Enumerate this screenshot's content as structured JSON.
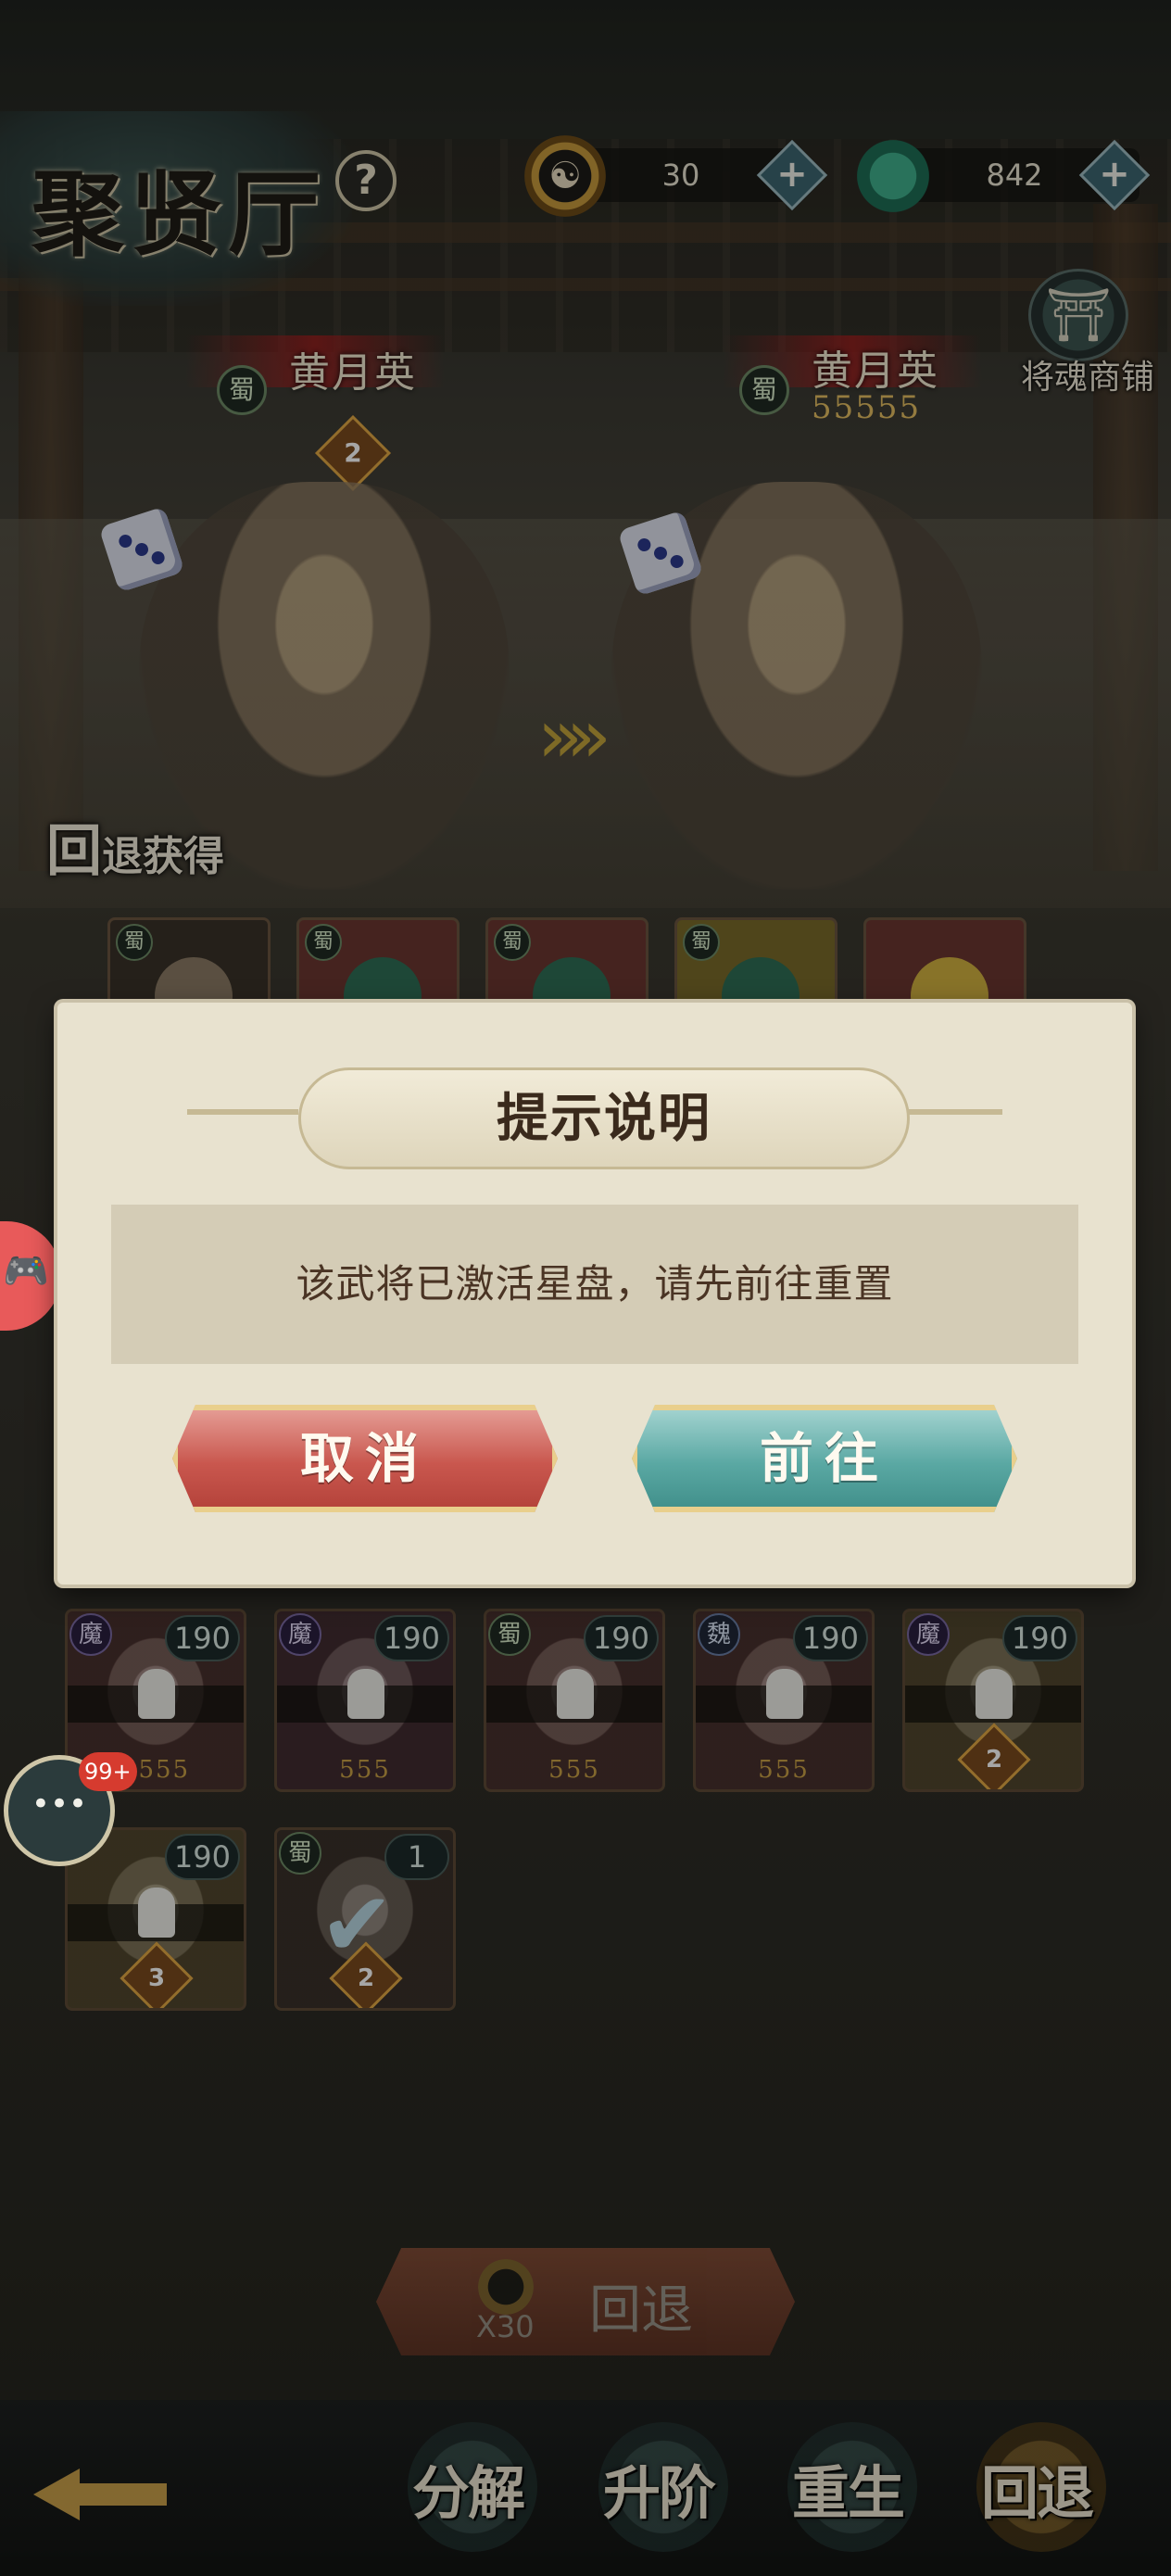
{
  "header": {
    "title": "聚贤厅",
    "help_icon": "question-mark-icon",
    "currency_yinyang": {
      "icon": "yinyang-coin-icon",
      "amount": "30"
    },
    "currency_jade": {
      "icon": "jade-dragon-icon",
      "amount": "842"
    },
    "plus_label": "+",
    "soul_shop_label": "将魂商铺"
  },
  "hero_preview": {
    "faction": "蜀",
    "left": {
      "name": "黄月英",
      "rank": "2"
    },
    "right": {
      "name": "黄月英",
      "souls": "55555"
    }
  },
  "retreat_section": {
    "label_main": "回",
    "label_sub": "退获得",
    "slots": [
      {
        "faction": "蜀",
        "color": "#8a7a64"
      },
      {
        "faction": "蜀",
        "color": "#2f6e55"
      },
      {
        "faction": "蜀",
        "color": "#2f6e55"
      },
      {
        "faction": "蜀",
        "color": "#2f6e55"
      },
      {
        "faction": "",
        "color": "#d2b13f"
      }
    ]
  },
  "hero_cards": [
    {
      "faction": "魔",
      "level": "190",
      "stars": "5555",
      "rank": ""
    },
    {
      "faction": "魔",
      "level": "190",
      "stars": "555",
      "rank": ""
    },
    {
      "faction": "蜀",
      "level": "190",
      "stars": "555",
      "rank": ""
    },
    {
      "faction": "魏",
      "level": "190",
      "stars": "555",
      "rank": ""
    },
    {
      "faction": "魔",
      "level": "190",
      "stars": "",
      "rank": "2"
    },
    {
      "faction": "",
      "level": "190",
      "stars": "",
      "rank": "3"
    },
    {
      "faction": "蜀",
      "level": "1",
      "stars": "",
      "rank": "2"
    }
  ],
  "floating": {
    "chat_badge": "99+"
  },
  "retreat_button": {
    "cost": "X30",
    "label": "回退"
  },
  "tabs": [
    {
      "label": "分解",
      "active": false
    },
    {
      "label": "升阶",
      "active": false
    },
    {
      "label": "重生",
      "active": false
    },
    {
      "label": "回退",
      "active": true
    }
  ],
  "modal": {
    "title": "提示说明",
    "message": "该武将已激活星盘，请先前往重置",
    "cancel_label": "取消",
    "confirm_label": "前往"
  }
}
